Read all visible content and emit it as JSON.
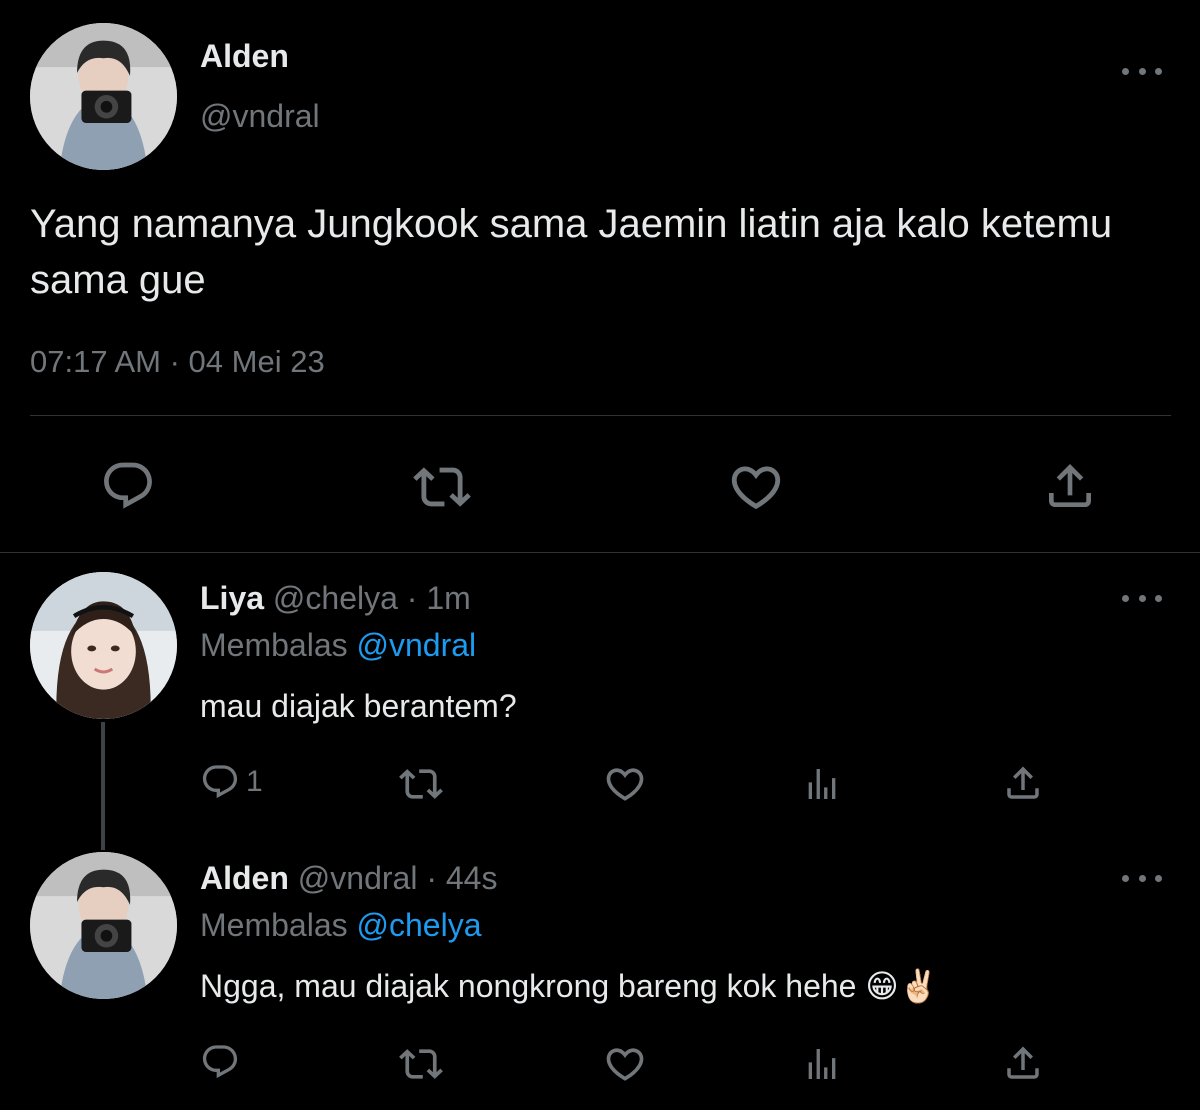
{
  "main_tweet": {
    "name": "Alden",
    "handle": "@vndral",
    "text": "Yang namanya Jungkook sama Jaemin liatin aja kalo ketemu sama gue",
    "time": "07:17 AM",
    "date": "04 Mei 23",
    "meta_separator": " · ",
    "actions": [
      "reply-icon",
      "retweet-icon",
      "like-icon",
      "share-icon"
    ]
  },
  "replies": [
    {
      "name": "Liya",
      "handle": "@chelya",
      "time": "1m",
      "reply_prefix": "Membalas",
      "reply_to": "@vndral",
      "text": "mau diajak berantem?",
      "reply_count": "1"
    },
    {
      "name": "Alden",
      "handle": "@vndral",
      "time": "44s",
      "reply_prefix": "Membalas",
      "reply_to": "@chelya",
      "text": "Ngga, mau diajak nongkrong bareng kok hehe 😁✌🏻",
      "reply_count": ""
    }
  ],
  "separator": " · ",
  "colors": {
    "background": "#000000",
    "text": "#e7e9ea",
    "muted": "#71767b",
    "link": "#1d9bf0",
    "divider": "#2f3336"
  }
}
